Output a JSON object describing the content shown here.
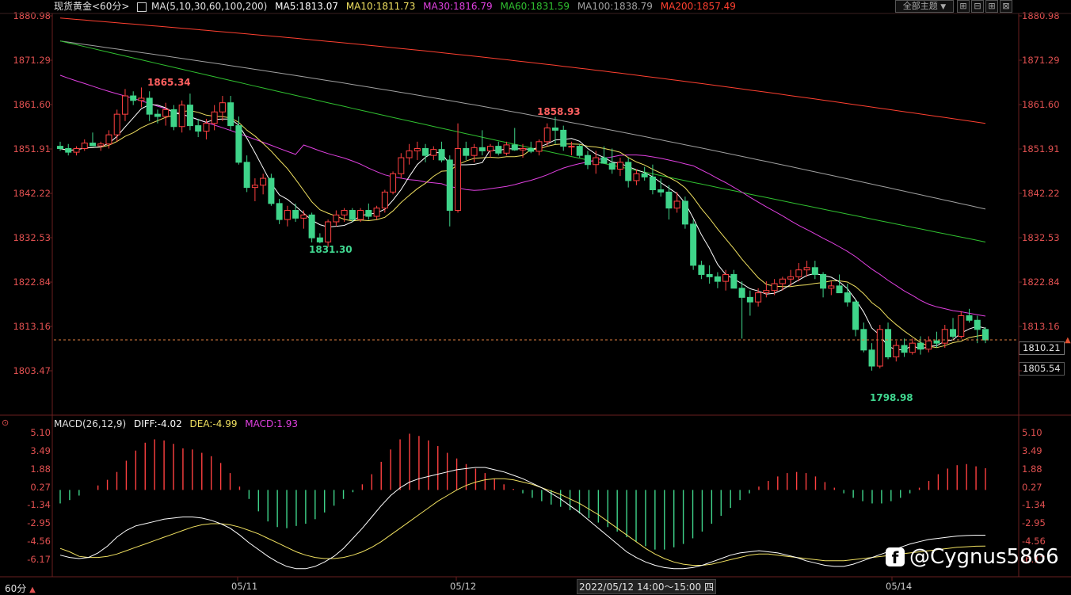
{
  "header": {
    "symbol": "现货黄金<60分>",
    "ma_params": "MA(5,10,30,60,100,200)",
    "ma5": "MA5:1813.07",
    "ma10": "MA10:1811.73",
    "ma30": "MA30:1816.79",
    "ma60": "MA60:1831.59",
    "ma100": "MA100:1838.79",
    "ma200": "MA200:1857.49"
  },
  "toolbar": {
    "theme_select": "全部主题",
    "theme_arrow": "▼"
  },
  "price_axis": {
    "labels": [
      "1880.98",
      "1871.29",
      "1861.60",
      "1851.91",
      "1842.22",
      "1832.53",
      "1822.84",
      "1813.16",
      "1803.47"
    ],
    "current_price": "1810.21",
    "lower_price": "1805.54"
  },
  "annotations": {
    "high1": "1865.34",
    "high2": "1858.93",
    "low1": "1831.30",
    "low2": "1798.98"
  },
  "macd": {
    "header": "MACD(26,12,9)",
    "diff": "DIFF:-4.02",
    "dea": "DEA:-4.99",
    "macd_val": "MACD:1.93",
    "labels": [
      "5.10",
      "3.49",
      "1.88",
      "0.27",
      "-1.34",
      "-2.95",
      "-4.56",
      "-6.17"
    ]
  },
  "footer": {
    "period": "60分",
    "period_arrow": "▲",
    "dates": [
      "05/11",
      "05/12",
      "05/14"
    ],
    "cursor_time": "2022/05/12 14:00～15:00 四"
  },
  "watermark": "@Cygnus5866",
  "colors": {
    "up": "#ff4040",
    "down": "#3fd48a",
    "ma5": "#ffffff",
    "ma10": "#f0e060",
    "ma30": "#e040e0",
    "ma60": "#30c030",
    "ma100": "#a0a0a0",
    "ma200": "#ff4030"
  },
  "chart_data": {
    "type": "candlestick",
    "price_range": [
      1798.98,
      1880.98
    ],
    "candles": [
      [
        1852.5,
        1853.5,
        1851.5,
        1852.0
      ],
      [
        1852.0,
        1853.0,
        1850.5,
        1851.2
      ],
      [
        1851.2,
        1852.5,
        1850.5,
        1852.0
      ],
      [
        1852.0,
        1854.0,
        1851.5,
        1853.2
      ],
      [
        1853.2,
        1855.5,
        1852.5,
        1852.6
      ],
      [
        1852.6,
        1853.5,
        1851.5,
        1853.0
      ],
      [
        1853.0,
        1856.0,
        1852.0,
        1855.0
      ],
      [
        1855.0,
        1860.5,
        1853.5,
        1859.5
      ],
      [
        1859.5,
        1865.0,
        1858.0,
        1863.5
      ],
      [
        1863.5,
        1864.5,
        1861.5,
        1862.5
      ],
      [
        1862.5,
        1865.34,
        1861.0,
        1863.0
      ],
      [
        1863.0,
        1864.5,
        1858.0,
        1859.5
      ],
      [
        1859.5,
        1860.5,
        1857.5,
        1859.0
      ],
      [
        1859.0,
        1862.0,
        1857.0,
        1860.5
      ],
      [
        1860.5,
        1861.5,
        1856.0,
        1856.8
      ],
      [
        1856.8,
        1862.5,
        1855.5,
        1861.5
      ],
      [
        1861.5,
        1864.0,
        1856.0,
        1857.0
      ],
      [
        1857.0,
        1858.5,
        1854.5,
        1855.8
      ],
      [
        1855.8,
        1858.5,
        1854.0,
        1857.5
      ],
      [
        1857.5,
        1861.5,
        1856.0,
        1860.0
      ],
      [
        1860.0,
        1863.5,
        1858.0,
        1862.0
      ],
      [
        1862.0,
        1863.5,
        1856.0,
        1857.0
      ],
      [
        1857.0,
        1859.0,
        1848.5,
        1849.0
      ],
      [
        1849.0,
        1850.5,
        1842.5,
        1843.5
      ],
      [
        1843.5,
        1845.5,
        1840.5,
        1844.0
      ],
      [
        1844.0,
        1846.5,
        1842.0,
        1845.5
      ],
      [
        1845.5,
        1846.5,
        1839.5,
        1840.0
      ],
      [
        1840.0,
        1841.0,
        1835.5,
        1836.5
      ],
      [
        1836.5,
        1839.5,
        1835.0,
        1838.5
      ],
      [
        1838.5,
        1840.0,
        1836.0,
        1836.8
      ],
      [
        1836.8,
        1838.5,
        1834.5,
        1837.5
      ],
      [
        1837.5,
        1838.0,
        1831.5,
        1832.5
      ],
      [
        1832.5,
        1833.5,
        1831.3,
        1831.6
      ],
      [
        1831.6,
        1836.5,
        1830.5,
        1836.0
      ],
      [
        1836.0,
        1838.5,
        1835.0,
        1837.5
      ],
      [
        1837.5,
        1839.0,
        1836.0,
        1838.5
      ],
      [
        1838.5,
        1839.0,
        1836.0,
        1836.5
      ],
      [
        1836.5,
        1839.0,
        1836.0,
        1838.5
      ],
      [
        1838.5,
        1840.0,
        1836.5,
        1837.2
      ],
      [
        1837.2,
        1839.5,
        1836.5,
        1839.0
      ],
      [
        1839.0,
        1843.0,
        1838.0,
        1842.5
      ],
      [
        1842.5,
        1847.0,
        1842.0,
        1846.5
      ],
      [
        1846.5,
        1851.0,
        1845.5,
        1850.0
      ],
      [
        1850.0,
        1853.0,
        1848.5,
        1851.5
      ],
      [
        1851.5,
        1853.5,
        1849.5,
        1852.0
      ],
      [
        1852.0,
        1853.0,
        1849.0,
        1850.5
      ],
      [
        1850.5,
        1852.5,
        1849.5,
        1851.8
      ],
      [
        1851.8,
        1853.5,
        1849.0,
        1849.5
      ],
      [
        1849.5,
        1850.5,
        1835.0,
        1838.5
      ],
      [
        1838.5,
        1857.5,
        1838.0,
        1852.0
      ],
      [
        1852.0,
        1853.5,
        1849.5,
        1850.5
      ],
      [
        1850.5,
        1853.0,
        1849.0,
        1852.2
      ],
      [
        1852.2,
        1856.0,
        1850.5,
        1851.5
      ],
      [
        1851.5,
        1853.0,
        1850.0,
        1852.5
      ],
      [
        1852.5,
        1853.5,
        1850.5,
        1851.0
      ],
      [
        1851.0,
        1853.5,
        1850.5,
        1852.8
      ],
      [
        1852.8,
        1856.5,
        1851.5,
        1851.7
      ],
      [
        1851.7,
        1853.0,
        1850.0,
        1852.0
      ],
      [
        1852.0,
        1853.5,
        1851.0,
        1851.4
      ],
      [
        1851.4,
        1854.0,
        1850.5,
        1853.5
      ],
      [
        1853.5,
        1857.5,
        1852.5,
        1856.5
      ],
      [
        1856.5,
        1858.93,
        1853.0,
        1856.0
      ],
      [
        1856.0,
        1857.0,
        1851.5,
        1852.5
      ],
      [
        1852.5,
        1853.5,
        1850.5,
        1852.5
      ],
      [
        1852.5,
        1853.0,
        1850.0,
        1850.5
      ],
      [
        1850.5,
        1851.5,
        1847.5,
        1848.5
      ],
      [
        1848.5,
        1851.5,
        1846.5,
        1850.0
      ],
      [
        1850.0,
        1852.5,
        1849.0,
        1848.8
      ],
      [
        1848.8,
        1852.0,
        1846.5,
        1847.5
      ],
      [
        1847.5,
        1850.0,
        1846.0,
        1849.0
      ],
      [
        1849.0,
        1850.0,
        1843.5,
        1845.0
      ],
      [
        1845.0,
        1847.5,
        1844.0,
        1846.5
      ],
      [
        1846.5,
        1848.0,
        1845.0,
        1845.8
      ],
      [
        1845.8,
        1848.5,
        1842.0,
        1843.0
      ],
      [
        1843.0,
        1845.5,
        1841.5,
        1842.5
      ],
      [
        1842.5,
        1844.0,
        1836.5,
        1839.0
      ],
      [
        1839.0,
        1842.5,
        1838.0,
        1840.5
      ],
      [
        1840.5,
        1841.5,
        1834.5,
        1835.5
      ],
      [
        1835.5,
        1836.5,
        1825.5,
        1826.5
      ],
      [
        1826.5,
        1827.5,
        1823.5,
        1824.5
      ],
      [
        1824.5,
        1826.5,
        1822.5,
        1824.0
      ],
      [
        1824.0,
        1825.0,
        1821.5,
        1823.0
      ],
      [
        1823.0,
        1825.5,
        1821.0,
        1824.5
      ],
      [
        1824.5,
        1825.5,
        1822.0,
        1821.5
      ],
      [
        1821.5,
        1823.0,
        1810.5,
        1819.5
      ],
      [
        1819.5,
        1821.0,
        1815.5,
        1818.5
      ],
      [
        1818.5,
        1821.5,
        1817.5,
        1820.5
      ],
      [
        1820.5,
        1823.0,
        1819.5,
        1821.0
      ],
      [
        1821.0,
        1823.5,
        1820.0,
        1822.5
      ],
      [
        1822.5,
        1824.0,
        1821.0,
        1823.5
      ],
      [
        1823.5,
        1825.5,
        1822.0,
        1824.0
      ],
      [
        1824.0,
        1827.0,
        1823.0,
        1825.5
      ],
      [
        1825.5,
        1827.5,
        1824.0,
        1826.0
      ],
      [
        1826.0,
        1827.5,
        1823.5,
        1824.5
      ],
      [
        1824.5,
        1825.0,
        1819.5,
        1821.5
      ],
      [
        1821.5,
        1823.0,
        1820.0,
        1822.0
      ],
      [
        1822.0,
        1824.5,
        1820.5,
        1820.5
      ],
      [
        1820.5,
        1822.5,
        1817.5,
        1818.5
      ],
      [
        1818.5,
        1819.0,
        1811.0,
        1812.5
      ],
      [
        1812.5,
        1814.0,
        1807.5,
        1808.0
      ],
      [
        1808.0,
        1809.5,
        1803.5,
        1804.5
      ],
      [
        1804.5,
        1813.5,
        1804.0,
        1812.5
      ],
      [
        1812.5,
        1814.0,
        1806.0,
        1806.5
      ],
      [
        1806.5,
        1810.0,
        1805.5,
        1809.0
      ],
      [
        1809.0,
        1810.5,
        1806.5,
        1807.5
      ],
      [
        1807.5,
        1810.5,
        1807.0,
        1809.5
      ],
      [
        1809.5,
        1811.0,
        1807.0,
        1808.2
      ],
      [
        1808.2,
        1811.0,
        1807.5,
        1810.0
      ],
      [
        1810.0,
        1812.0,
        1808.5,
        1809.5
      ],
      [
        1809.5,
        1813.5,
        1808.5,
        1812.5
      ],
      [
        1812.5,
        1815.0,
        1810.5,
        1811.0
      ],
      [
        1811.0,
        1816.5,
        1810.5,
        1815.5
      ],
      [
        1815.5,
        1817.0,
        1814.0,
        1814.5
      ],
      [
        1814.5,
        1815.5,
        1809.5,
        1812.5
      ],
      [
        1812.5,
        1813.0,
        1809.5,
        1810.2
      ]
    ],
    "macd_range": [
      -7.8,
      5.6
    ],
    "macd_hist": [
      -1.2,
      -0.9,
      -0.5,
      0.0,
      0.4,
      0.9,
      1.6,
      2.6,
      3.5,
      4.2,
      4.5,
      4.4,
      4.1,
      3.7,
      3.6,
      3.3,
      3.0,
      2.4,
      1.5,
      0.3,
      -0.8,
      -1.9,
      -2.8,
      -3.3,
      -3.4,
      -3.2,
      -3.0,
      -2.6,
      -2.0,
      -1.4,
      -0.8,
      -0.2,
      0.5,
      1.4,
      2.5,
      3.6,
      4.5,
      5.0,
      4.8,
      4.4,
      3.9,
      3.3,
      2.8,
      2.3,
      1.9,
      1.5,
      1.0,
      0.5,
      0.1,
      -0.3,
      -0.7,
      -1.0,
      -1.3,
      -1.5,
      -1.8,
      -2.1,
      -2.5,
      -2.9,
      -3.3,
      -3.7,
      -4.2,
      -4.6,
      -5.0,
      -5.3,
      -5.3,
      -5.1,
      -4.8,
      -4.3,
      -3.7,
      -3.0,
      -2.3,
      -1.6,
      -0.9,
      -0.3,
      0.3,
      0.8,
      1.2,
      1.5,
      1.6,
      1.5,
      1.2,
      0.7,
      0.2,
      -0.3,
      -0.7,
      -1.0,
      -1.2,
      -1.2,
      -1.0,
      -0.7,
      -0.3,
      0.2,
      0.8,
      1.4,
      1.9,
      2.2,
      2.3,
      2.1,
      1.93
    ],
    "diff": [
      -5.8,
      -6.0,
      -6.1,
      -6.0,
      -5.6,
      -5.0,
      -4.2,
      -3.6,
      -3.2,
      -3.0,
      -2.8,
      -2.6,
      -2.5,
      -2.4,
      -2.4,
      -2.5,
      -2.7,
      -3.0,
      -3.4,
      -4.0,
      -4.7,
      -5.3,
      -5.9,
      -6.4,
      -6.8,
      -7.0,
      -7.0,
      -6.8,
      -6.4,
      -5.9,
      -5.2,
      -4.3,
      -3.4,
      -2.4,
      -1.4,
      -0.5,
      0.2,
      0.7,
      1.0,
      1.2,
      1.4,
      1.6,
      1.8,
      1.9,
      2.0,
      2.0,
      1.8,
      1.6,
      1.3,
      1.0,
      0.6,
      0.2,
      -0.3,
      -0.8,
      -1.4,
      -2.0,
      -2.7,
      -3.4,
      -4.1,
      -4.8,
      -5.5,
      -6.0,
      -6.4,
      -6.7,
      -6.9,
      -7.0,
      -7.0,
      -6.9,
      -6.7,
      -6.4,
      -6.1,
      -5.8,
      -5.6,
      -5.5,
      -5.4,
      -5.5,
      -5.6,
      -5.8,
      -6.0,
      -6.3,
      -6.5,
      -6.7,
      -6.8,
      -6.8,
      -6.6,
      -6.3,
      -6.0,
      -5.7,
      -5.4,
      -5.1,
      -4.8,
      -4.6,
      -4.4,
      -4.3,
      -4.2,
      -4.1,
      -4.05,
      -4.02,
      -4.02
    ],
    "dea": [
      -5.2,
      -5.5,
      -5.9,
      -6.0,
      -6.0,
      -5.9,
      -5.7,
      -5.4,
      -5.1,
      -4.8,
      -4.5,
      -4.2,
      -3.9,
      -3.6,
      -3.3,
      -3.1,
      -3.0,
      -3.0,
      -3.1,
      -3.3,
      -3.6,
      -3.9,
      -4.3,
      -4.7,
      -5.1,
      -5.5,
      -5.8,
      -6.0,
      -6.1,
      -6.1,
      -6.0,
      -5.8,
      -5.5,
      -5.1,
      -4.6,
      -4.0,
      -3.4,
      -2.8,
      -2.2,
      -1.6,
      -1.0,
      -0.5,
      0.0,
      0.4,
      0.7,
      0.9,
      1.0,
      1.0,
      0.9,
      0.7,
      0.5,
      0.2,
      -0.1,
      -0.4,
      -0.8,
      -1.2,
      -1.7,
      -2.2,
      -2.8,
      -3.4,
      -4.0,
      -4.6,
      -5.2,
      -5.7,
      -6.1,
      -6.4,
      -6.6,
      -6.7,
      -6.7,
      -6.6,
      -6.4,
      -6.2,
      -6.0,
      -5.8,
      -5.7,
      -5.7,
      -5.8,
      -5.9,
      -6.0,
      -6.1,
      -6.2,
      -6.3,
      -6.3,
      -6.3,
      -6.2,
      -6.1,
      -6.0,
      -5.9,
      -5.8,
      -5.7,
      -5.6,
      -5.5,
      -5.4,
      -5.3,
      -5.2,
      -5.1,
      -5.05,
      -5.0,
      -4.99
    ]
  }
}
